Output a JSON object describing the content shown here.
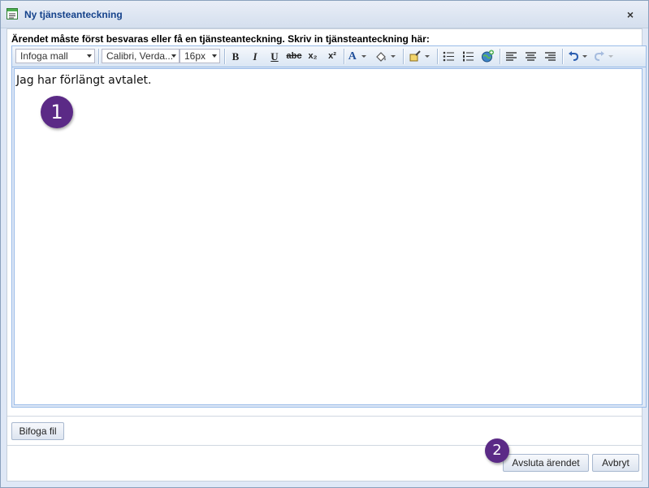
{
  "window": {
    "title": "Ny tjänsteanteckning",
    "close_symbol": "×"
  },
  "prompt": "Ärendet måste först besvaras eller få en tjänsteanteckning. Skriv in tjänsteanteckning här:",
  "toolbar": {
    "template_select": "Infoga mall",
    "font_select": "Calibri, Verda...",
    "size_select": "16px",
    "bold": "B",
    "italic": "I",
    "underline": "U",
    "strikethrough": "abc",
    "subscript": "x₂",
    "superscript": "x²",
    "font_color": "A"
  },
  "editor": {
    "content": "Jag har förlängt avtalet."
  },
  "attach_button": "Bifoga fil",
  "footer": {
    "close_case_button": "Avsluta ärendet",
    "cancel_button": "Avbryt"
  },
  "annotations": {
    "badge1": "1",
    "badge2": "2",
    "badge_color": "#5b2a86"
  },
  "colors": {
    "title_text": "#15428b",
    "frame_border": "#99bbe8"
  }
}
